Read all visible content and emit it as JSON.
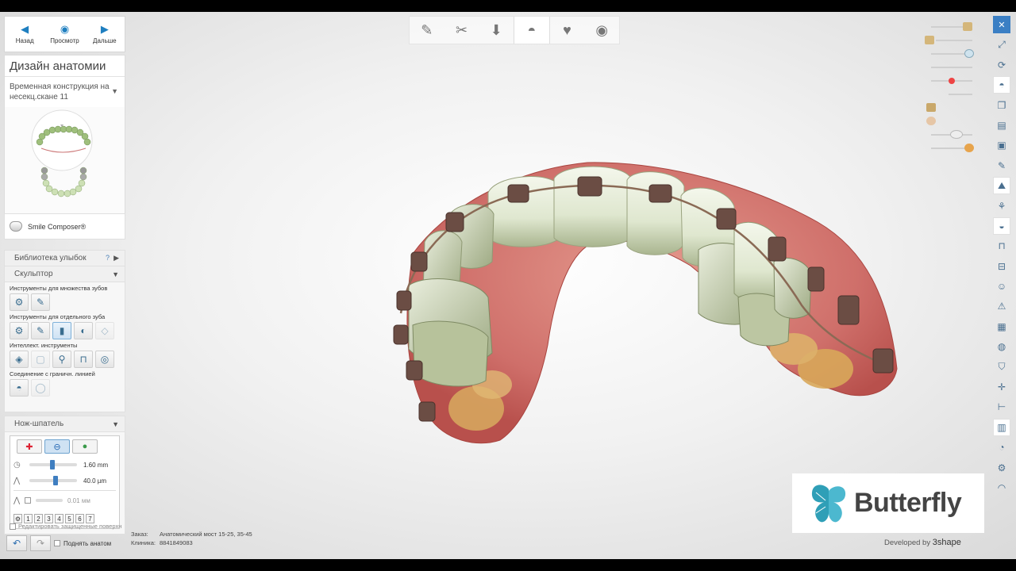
{
  "nav": {
    "back": "Назад",
    "preview": "Просмотр",
    "next": "Дальше"
  },
  "panel": {
    "title": "Дизайн анатомии",
    "restoration": "Временная конструкция на несекц.скане 11",
    "smile_composer": "Smile Composer®"
  },
  "tools": {
    "library": "Библиотека улыбок",
    "library_help": "?",
    "sculpt": "Скульптор",
    "multi_teeth": "Инструменты для множества зубов",
    "single_tooth": "Инструменты для отдельного зуба",
    "smart": "Интеллект. инструменты",
    "margin": "Соединение с граничн. линией"
  },
  "knife": {
    "title": "Нож-шпатель",
    "size_value": "1.60 mm",
    "depth_value": "40.0 µm",
    "offset_value": "0.01",
    "offset_unit": "мм",
    "keys": [
      "1",
      "2",
      "3",
      "4",
      "5",
      "6",
      "7"
    ],
    "size_fraction": 0.48,
    "depth_fraction": 0.55
  },
  "bottom": {
    "protected": "Редактировать защищенные поверхн",
    "lift": "Поднять анатом"
  },
  "order": {
    "order_key": "Заказ:",
    "order_value": "Анатомический мост 15-25, 35-45",
    "client_key": "Клиника:",
    "client_value": "8841849083"
  },
  "logo": {
    "name": "Butterfly",
    "developed_by": "Developed by",
    "brand": "3shape"
  },
  "colors": {
    "accent": "#3b7fc4",
    "logo_icon": "#2f9fb7",
    "gum": "#c96a6a",
    "tooth": "#e8eedc"
  }
}
